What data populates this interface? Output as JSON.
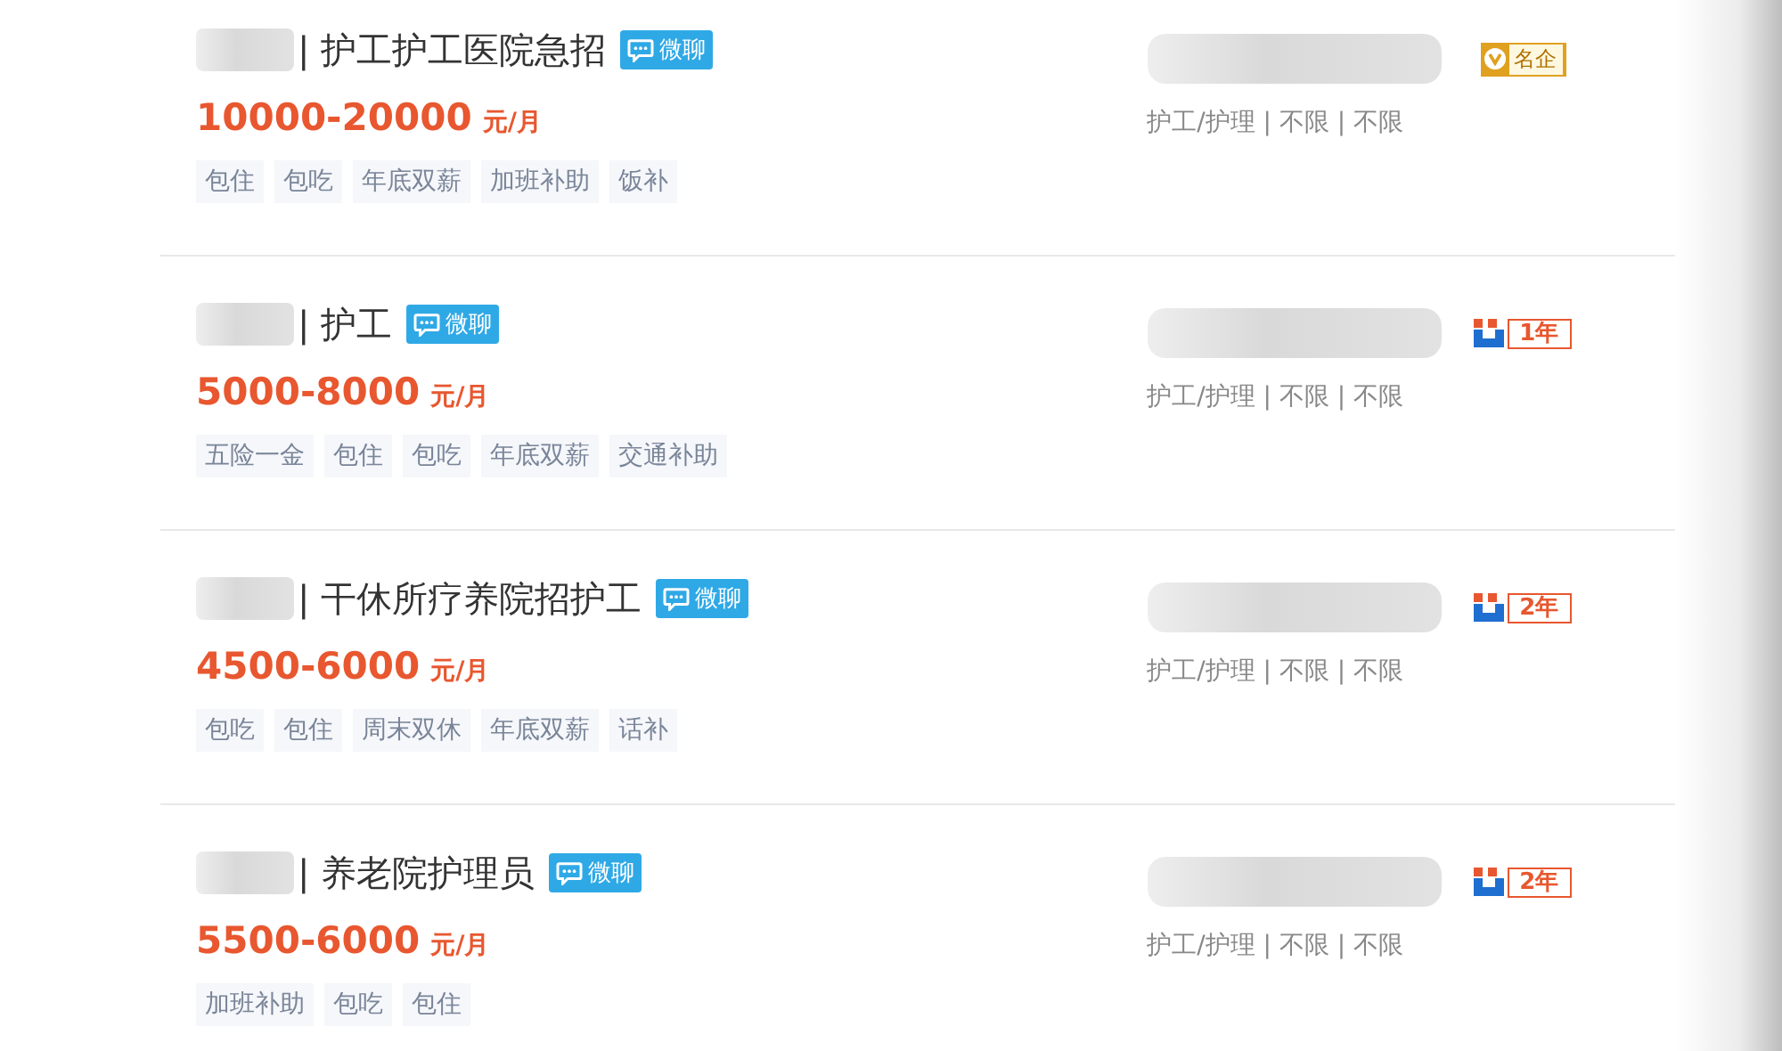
{
  "jobs": [
    {
      "title": "| 护工护工医院急招",
      "chat_badge": "微聊",
      "salary": "10000-20000",
      "unit": "元/月",
      "tags": [
        "包住",
        "包吃",
        "年底双薪",
        "加班补助",
        "饭补"
      ],
      "company_badge": {
        "kind": "vip",
        "label": "名企"
      },
      "meta": "护工/护理 | 不限 | 不限"
    },
    {
      "title": "| 护工",
      "chat_badge": "微聊",
      "salary": "5000-8000",
      "unit": "元/月",
      "tags": [
        "五险一金",
        "包住",
        "包吃",
        "年底双薪",
        "交通补助"
      ],
      "company_badge": {
        "kind": "years",
        "label": "1年"
      },
      "meta": "护工/护理 | 不限 | 不限"
    },
    {
      "title": "| 干休所疗养院招护工",
      "chat_badge": "微聊",
      "salary": "4500-6000",
      "unit": "元/月",
      "tags": [
        "包吃",
        "包住",
        "周末双休",
        "年底双薪",
        "话补"
      ],
      "company_badge": {
        "kind": "years",
        "label": "2年"
      },
      "meta": "护工/护理 | 不限 | 不限"
    },
    {
      "title": "| 养老院护理员",
      "chat_badge": "微聊",
      "salary": "5500-6000",
      "unit": "元/月",
      "tags": [
        "加班补助",
        "包吃",
        "包住"
      ],
      "company_badge": {
        "kind": "years",
        "label": "2年"
      },
      "meta": "护工/护理 | 不限 | 不限"
    }
  ]
}
